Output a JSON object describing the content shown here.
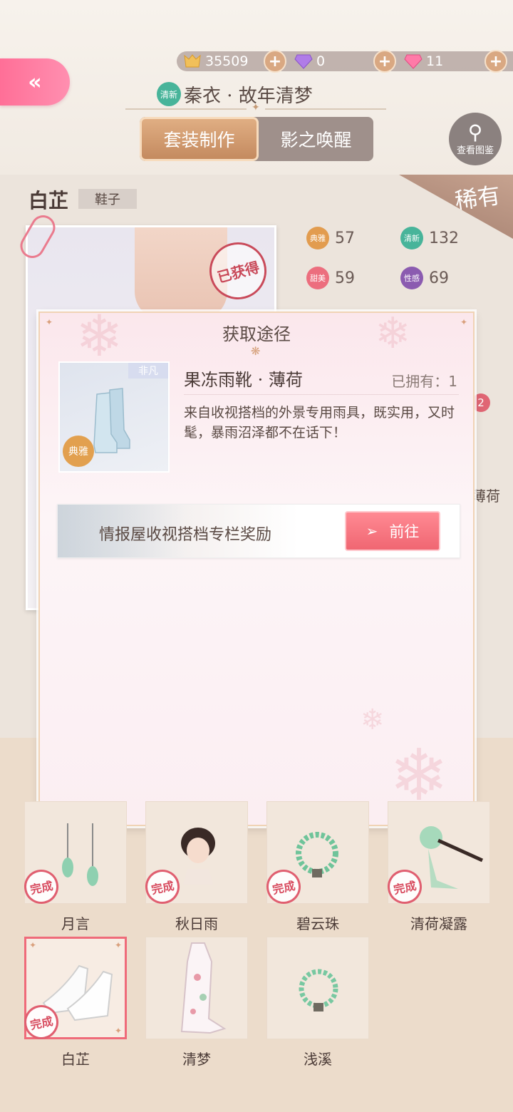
{
  "currency": [
    {
      "icon": "coin-icon",
      "value": "35509"
    },
    {
      "icon": "diamond-icon",
      "value": "0"
    },
    {
      "icon": "pink-diamond-icon",
      "value": "11"
    }
  ],
  "suit": {
    "tag": "清新",
    "title": "秦衣 · 故年清梦"
  },
  "tabs": [
    {
      "label": "套装制作",
      "active": true
    },
    {
      "label": "影之唤醒",
      "active": false
    }
  ],
  "gallery_button": "查看图鉴",
  "item": {
    "name": "白芷",
    "type": "鞋子",
    "rarity": "稀有",
    "obtained_stamp": "已获得",
    "attributes": [
      {
        "tag": "典雅",
        "value": "57",
        "color": "#e29c4f"
      },
      {
        "tag": "清新",
        "value": "132",
        "color": "#48b49a"
      },
      {
        "tag": "甜美",
        "value": "59",
        "color": "#ec6e7e"
      },
      {
        "tag": "性感",
        "value": "69",
        "color": "#8b5bb0"
      }
    ]
  },
  "behind": {
    "badge": "2",
    "label": "薄荷"
  },
  "dialog": {
    "title": "获取途径",
    "thumb_tag": "非凡",
    "thumb_style": "典雅",
    "item_name": "果冻雨靴 · 薄荷",
    "owned": "已拥有：1",
    "description": "来自收视搭档的外景专用雨具，既实用，又时髦，暴雨沼泽都不在话下！",
    "route_label": "情报屋收视搭档专栏奖励",
    "go_button": "前往"
  },
  "done_label": "完成",
  "parts": [
    {
      "label": "月言",
      "done": true
    },
    {
      "label": "秋日雨",
      "done": true
    },
    {
      "label": "碧云珠",
      "done": true
    },
    {
      "label": "清荷凝露",
      "done": true
    },
    {
      "label": "白芷",
      "done": true,
      "selected": true
    },
    {
      "label": "清梦",
      "done": false
    },
    {
      "label": "浅溪",
      "done": false
    }
  ],
  "colors": {
    "accent_pink": "#ff6f97",
    "tab_gold": "#c48a5f",
    "stamp_red": "#e05f70"
  }
}
